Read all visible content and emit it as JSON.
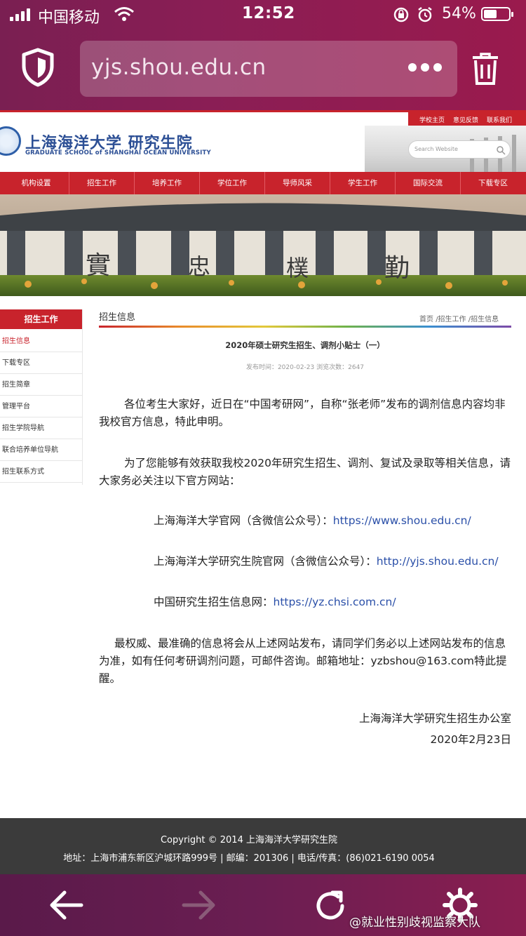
{
  "status_bar": {
    "carrier": "中国移动",
    "time": "12:52",
    "battery_percent": "54%",
    "battery_level": 0.54
  },
  "browser": {
    "url": "yjs.shou.edu.cn"
  },
  "site": {
    "logo_cn": "上海海洋大学 研究生院",
    "logo_en": "GRADUATE SCHOOL of SHANGHAI OCEAN UNIVERSITY",
    "top_links": [
      "学校主页",
      "意见反馈",
      "联系我们"
    ],
    "search_placeholder": "Search Website",
    "nav": [
      "机构设置",
      "招生工作",
      "培养工作",
      "学位工作",
      "导师风采",
      "学生工作",
      "国际交流",
      "下载专区"
    ],
    "banner_chars": [
      "實",
      "忠",
      "樸",
      "勤"
    ]
  },
  "sidebar": {
    "heading": "招生工作",
    "items": [
      "招生信息",
      "下载专区",
      "招生简章",
      "管理平台",
      "招生学院导航",
      "联合培养单位导航",
      "招生联系方式"
    ]
  },
  "content": {
    "section_title": "招生信息",
    "breadcrumb": [
      "首页",
      "/招生工作",
      "/招生信息"
    ],
    "article_title": "2020年硕士研究生招生、调剂小贴士（一）",
    "meta": "发布时间：2020-02-23   浏览次数：2647",
    "para1": "各位考生大家好，近日在“中国考研网”，自称“张老师”发布的调剂信息内容均非",
    "para1b": "我校官方信息，特此申明。",
    "para2": "为了您能够有效获取我校2020年研究生招生、调剂、复试及录取等相关信息，请",
    "para2b": "大家务必关注以下官方网站：",
    "site1_label": "上海海洋大学官网（含微信公众号）：",
    "site1_url": "https://www.shou.edu.cn/",
    "site2_label": "上海海洋大学研究生院官网（含微信公众号）：",
    "site2_url": "http://yjs.shou.edu.cn/",
    "site3_label": "中国研究生招生信息网：",
    "site3_url": "https://yz.chsi.com.cn/",
    "para3": "最权威、最准确的信息将会从上述网站发布，请同学们务必以上述网站发布的信息",
    "para3b": "为准，如有任何考研调剂问题，可邮件咨询。邮箱地址：yzbshou@163.com特此提",
    "para3c": "醒。",
    "sign_org": "上海海洋大学研究生招生办公室",
    "sign_date": "2020年2月23日"
  },
  "footer": {
    "copyright": "Copyright © 2014 上海海洋大学研究生院",
    "address": "地址：上海市浦东新区沪城环路999号 | 邮编：201306 | 电话/传真：(86)021-6190 0054"
  },
  "watermark": "@就业性别歧视监察大队",
  "colors": {
    "brand_red": "#c8232c",
    "browser_chrome": "#8a1e55",
    "link_blue": "#2a4fa8"
  }
}
